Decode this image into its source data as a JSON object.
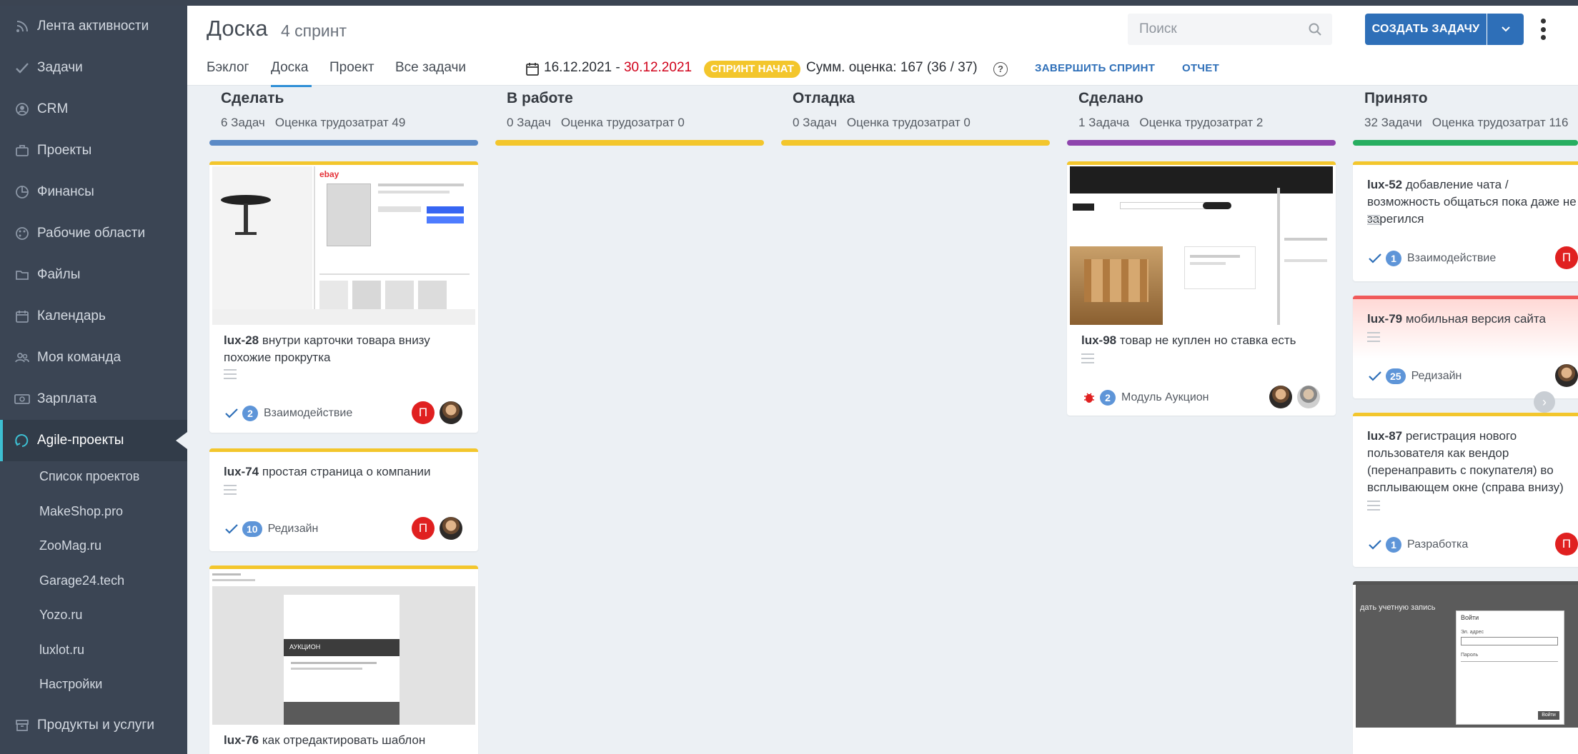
{
  "sidebar": {
    "items": [
      {
        "label": "Лента активности",
        "icon": "rss-icon"
      },
      {
        "label": "Задачи",
        "icon": "check-icon"
      },
      {
        "label": "CRM",
        "icon": "user-circle-icon"
      },
      {
        "label": "Проекты",
        "icon": "briefcase-icon"
      },
      {
        "label": "Финансы",
        "icon": "pie-chart-icon"
      },
      {
        "label": "Рабочие области",
        "icon": "palette-icon"
      },
      {
        "label": "Файлы",
        "icon": "folder-icon"
      },
      {
        "label": "Календарь",
        "icon": "calendar-icon"
      },
      {
        "label": "Моя команда",
        "icon": "team-icon"
      },
      {
        "label": "Зарплата",
        "icon": "money-icon"
      },
      {
        "label": "Agile-проекты",
        "icon": "agile-icon"
      }
    ],
    "sub_items": [
      "Список проектов",
      "MakeShop.pro",
      "ZooMag.ru",
      "Garage24.tech",
      "Yozo.ru",
      "luxlot.ru",
      "Настройки"
    ],
    "bottom_item": {
      "label": "Продукты и услуги",
      "icon": "box-icon"
    }
  },
  "header": {
    "title": "Доска",
    "subtitle": "4 спринт",
    "search_placeholder": "Поиск",
    "create_label": "СОЗДАТЬ ЗАДАЧУ",
    "tabs": [
      "Бэклог",
      "Доска",
      "Проект",
      "Все задачи"
    ],
    "active_tab": "Доска",
    "date_start": "16.12.2021",
    "date_sep": " - ",
    "date_end": "30.12.2021",
    "sprint_badge": "СПРИНТ НАЧАТ",
    "sum_label": "Сумм. оценка:",
    "sum_value": "167",
    "sum_detail": "(36 / 37)",
    "finish_label": "ЗАВЕРШИТЬ СПРИНТ",
    "report_label": "ОТЧЕТ",
    "colors": {
      "accent": "#2e6fb8",
      "badge": "#f3c62c",
      "date_end": "#d0021b"
    }
  },
  "columns": [
    {
      "title": "Сделать",
      "summary": "6 Задач   Оценка трудозатрат 49",
      "color": "#5b8ac6"
    },
    {
      "title": "В работе",
      "summary": "0 Задач   Оценка трудозатрат 0",
      "color": "#f3c62c"
    },
    {
      "title": "Отладка",
      "summary": "0 Задач   Оценка трудозатрат 0",
      "color": "#f3c62c"
    },
    {
      "title": "Сделано",
      "summary": "1 Задача   Оценка трудозатрат 2",
      "color": "#8e44ad"
    },
    {
      "title": "Принято",
      "summary": "32 Задачи   Оценка трудозатрат 116",
      "color": "#27ae60"
    }
  ],
  "cards": {
    "lux28": {
      "key": "lux-28",
      "title": "внутри карточки товара внизу похожие прокрутка",
      "count": "2",
      "tag": "Взаимодействие",
      "avatar": "П"
    },
    "lux74": {
      "key": "lux-74",
      "title": "простая страница о компании",
      "count": "10",
      "tag": "Редизайн",
      "avatar": "П"
    },
    "lux76": {
      "key": "lux-76",
      "title": "как отредактировать шаблон"
    },
    "lux98": {
      "key": "lux-98",
      "title": "товар не куплен но ставка есть",
      "count": "2",
      "tag": "Модуль Аукцион"
    },
    "lux52": {
      "key": "lux-52",
      "title": "добавление чата / возможность общаться пока даже не зарегился",
      "count": "1",
      "tag": "Взаимодействие",
      "avatar": "П"
    },
    "lux79": {
      "key": "lux-79",
      "title": "мобильная версия сайта",
      "count": "25",
      "tag": "Редизайн"
    },
    "lux87": {
      "key": "lux-87",
      "title": "регистрация нового пользователя как вендор (перенаправить с покупателя) во всплывающем окне (справа внизу)",
      "count": "1",
      "tag": "Разработка",
      "avatar": "П"
    }
  },
  "thumbs": {
    "ebay_logo": "ebay",
    "auction_label": "АУКЦИОН",
    "login_title": "Войти",
    "login_email": "Эл. адрес",
    "login_pass": "Пароль",
    "login_btn": "Войти",
    "login_side": "дать учетную запись"
  }
}
